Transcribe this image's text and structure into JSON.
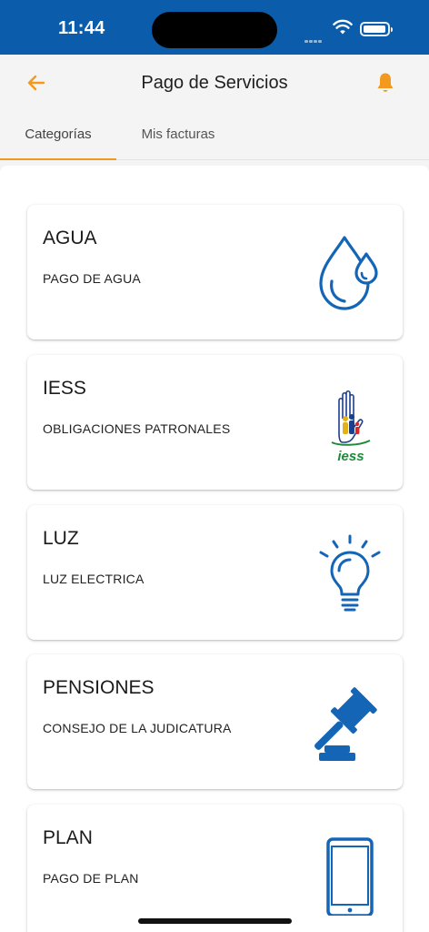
{
  "status_bar": {
    "time": "11:44"
  },
  "header": {
    "title": "Pago de Servicios"
  },
  "tabs": [
    {
      "label": "Categorías",
      "active": true
    },
    {
      "label": "Mis facturas",
      "active": false
    }
  ],
  "colors": {
    "primary_blue": "#0b5cab",
    "accent_orange": "#f39a1e",
    "icon_blue": "#1565b6",
    "iess_green": "#1f8a3a"
  },
  "categories": [
    {
      "title": "AGUA",
      "subtitle": "PAGO DE AGUA",
      "icon": "water-drops-icon"
    },
    {
      "title": "IESS",
      "subtitle": "OBLIGACIONES PATRONALES",
      "icon": "iess-logo"
    },
    {
      "title": "LUZ",
      "subtitle": "LUZ ELECTRICA",
      "icon": "light-bulb-icon"
    },
    {
      "title": "PENSIONES",
      "subtitle": "CONSEJO DE LA JUDICATURA",
      "icon": "gavel-icon"
    },
    {
      "title": "PLAN",
      "subtitle": "PAGO DE PLAN",
      "icon": "smartphone-icon"
    }
  ]
}
